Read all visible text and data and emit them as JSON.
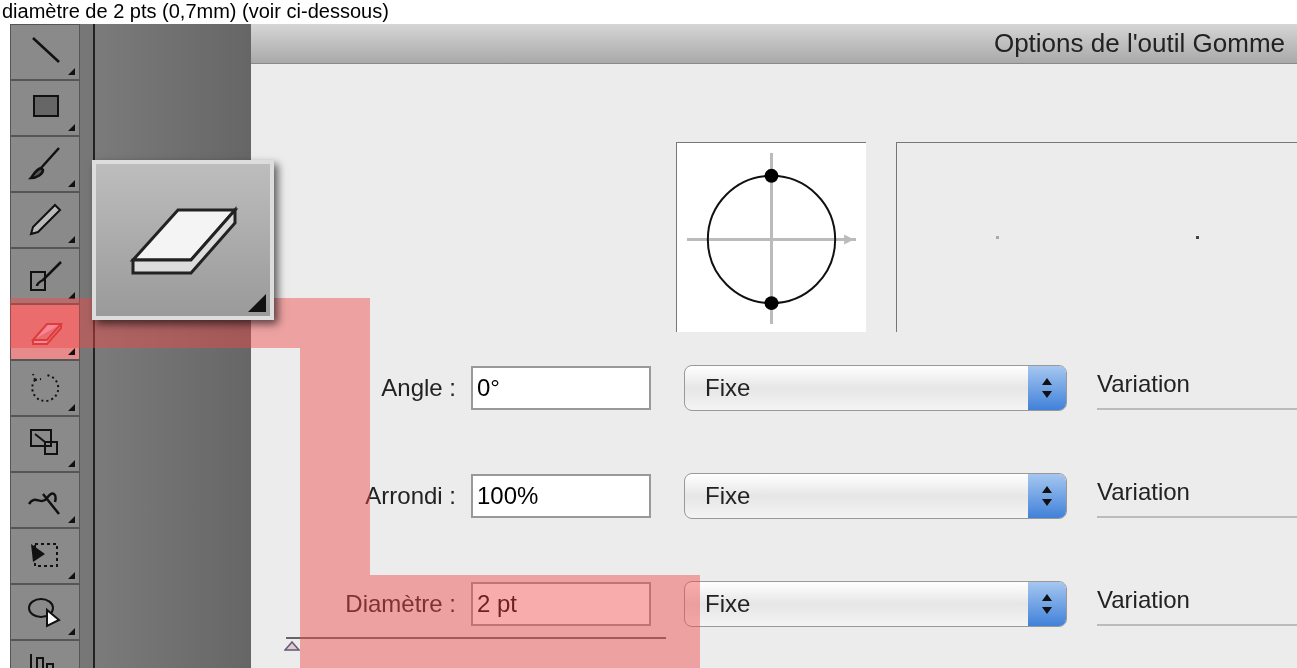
{
  "caption": "diamètre de 2 pts (0,7mm) (voir ci-dessous)",
  "tools": [
    {
      "kind": "line",
      "selected": false
    },
    {
      "kind": "rectangle",
      "selected": false
    },
    {
      "kind": "brush",
      "selected": false
    },
    {
      "kind": "pencil",
      "selected": false
    },
    {
      "kind": "blob",
      "selected": false
    },
    {
      "kind": "eraser",
      "selected": true
    },
    {
      "kind": "rotate",
      "selected": false
    },
    {
      "kind": "scale",
      "selected": false
    },
    {
      "kind": "warp",
      "selected": false
    },
    {
      "kind": "transform",
      "selected": false
    },
    {
      "kind": "sprayer",
      "selected": false
    },
    {
      "kind": "graph",
      "selected": false
    }
  ],
  "dialog": {
    "title": "Options de l'outil Gomme"
  },
  "rows": [
    {
      "label": "Angle :",
      "value": "0°",
      "mode": "Fixe",
      "variation": "Variation"
    },
    {
      "label": "Arrondi :",
      "value": "100%",
      "mode": "Fixe",
      "variation": "Variation"
    },
    {
      "label": "Diamètre :",
      "value": "2 pt",
      "mode": "Fixe",
      "variation": "Variation",
      "slider": {
        "level": 0
      }
    }
  ]
}
